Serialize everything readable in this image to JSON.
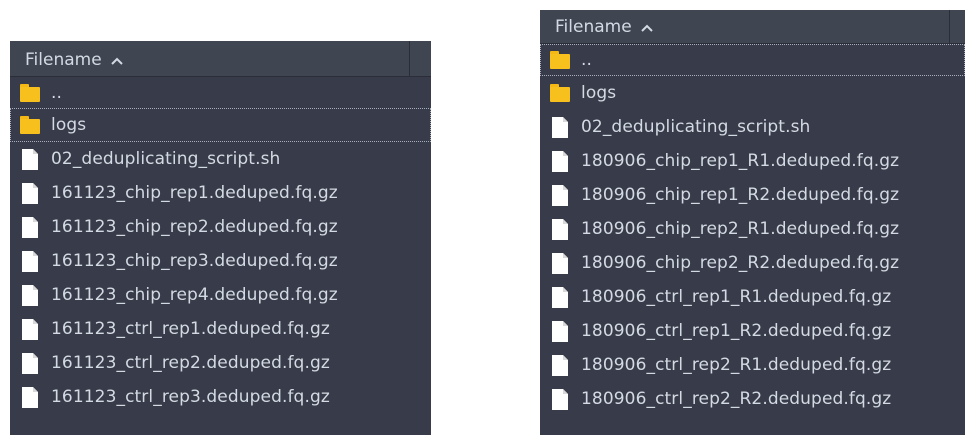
{
  "left_panel": {
    "column_header": "Filename",
    "sort_icon": "chevron-up-icon",
    "rows": [
      {
        "name": "..",
        "type": "folder"
      },
      {
        "name": "logs",
        "type": "folder"
      },
      {
        "name": "02_deduplicating_script.sh",
        "type": "file"
      },
      {
        "name": "161123_chip_rep1.deduped.fq.gz",
        "type": "file"
      },
      {
        "name": "161123_chip_rep2.deduped.fq.gz",
        "type": "file"
      },
      {
        "name": "161123_chip_rep3.deduped.fq.gz",
        "type": "file"
      },
      {
        "name": "161123_chip_rep4.deduped.fq.gz",
        "type": "file"
      },
      {
        "name": "161123_ctrl_rep1.deduped.fq.gz",
        "type": "file"
      },
      {
        "name": "161123_ctrl_rep2.deduped.fq.gz",
        "type": "file"
      },
      {
        "name": "161123_ctrl_rep3.deduped.fq.gz",
        "type": "file"
      }
    ]
  },
  "right_panel": {
    "column_header": "Filename",
    "sort_icon": "chevron-up-icon",
    "rows": [
      {
        "name": "..",
        "type": "folder"
      },
      {
        "name": "logs",
        "type": "folder"
      },
      {
        "name": "02_deduplicating_script.sh",
        "type": "file"
      },
      {
        "name": "180906_chip_rep1_R1.deduped.fq.gz",
        "type": "file"
      },
      {
        "name": "180906_chip_rep1_R2.deduped.fq.gz",
        "type": "file"
      },
      {
        "name": "180906_chip_rep2_R1.deduped.fq.gz",
        "type": "file"
      },
      {
        "name": "180906_chip_rep2_R2.deduped.fq.gz",
        "type": "file"
      },
      {
        "name": "180906_ctrl_rep1_R1.deduped.fq.gz",
        "type": "file"
      },
      {
        "name": "180906_ctrl_rep1_R2.deduped.fq.gz",
        "type": "file"
      },
      {
        "name": "180906_ctrl_rep2_R1.deduped.fq.gz",
        "type": "file"
      },
      {
        "name": "180906_ctrl_rep2_R2.deduped.fq.gz",
        "type": "file"
      }
    ]
  },
  "colors": {
    "panel_bg": "#383c4a",
    "header_bg": "#404552",
    "text": "#d3dae3",
    "folder": "#f8c01d",
    "file": "#ffffff"
  }
}
